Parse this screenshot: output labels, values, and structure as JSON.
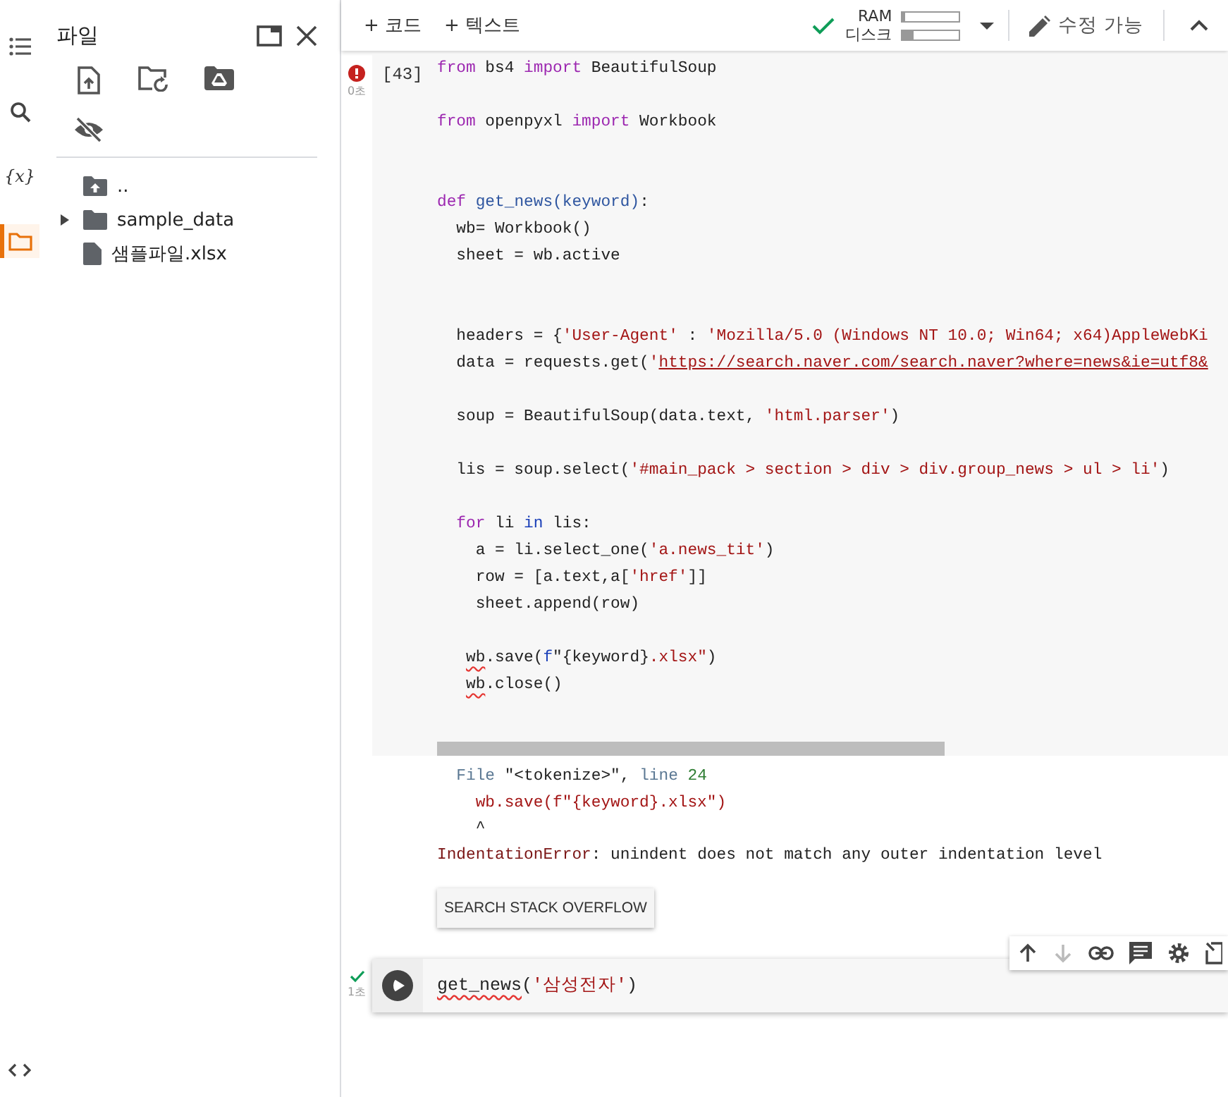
{
  "rail": {
    "items": [
      {
        "kind": "toc",
        "selected": false
      },
      {
        "kind": "search",
        "selected": false
      },
      {
        "kind": "variables",
        "glyph": "{x}",
        "selected": false
      },
      {
        "kind": "files",
        "selected": true
      }
    ]
  },
  "files_panel": {
    "title": "파일",
    "actions": [
      {
        "kind": "upload"
      },
      {
        "kind": "refresh-folder"
      },
      {
        "kind": "drive"
      },
      {
        "kind": "hide"
      }
    ],
    "tree": [
      {
        "name": "..",
        "kind": "parent"
      },
      {
        "name": "sample_data",
        "kind": "folder",
        "expanded": false
      },
      {
        "name": "샘플파일.xlsx",
        "kind": "file"
      }
    ]
  },
  "toolbar": {
    "add_buttons": [
      "+ 코드",
      "+ 텍스트"
    ],
    "ram_label": "RAM",
    "ram": {
      "level": 0.06
    },
    "disk_label": "디스크",
    "disk": {
      "level": 0.2
    },
    "connected": true,
    "edit_label": "수정 가능"
  },
  "cells": [
    {
      "error": true,
      "time": "0초",
      "count": "[43]",
      "lines": [
        {
          "kind": "code",
          "tokens": [
            {
              "kind": "keyword",
              "text": "from"
            },
            {
              "kind": "plain",
              "text": " bs4 "
            },
            {
              "kind": "keyword",
              "text": "import"
            },
            {
              "kind": "plain",
              "text": " BeautifulSoup"
            }
          ]
        },
        {
          "kind": "blank"
        },
        {
          "kind": "code",
          "tokens": [
            {
              "kind": "keyword",
              "text": "from"
            },
            {
              "kind": "plain",
              "text": " openpyxl "
            },
            {
              "kind": "keyword",
              "text": "import"
            },
            {
              "kind": "plain",
              "text": " Workbook"
            }
          ]
        },
        {
          "kind": "blank"
        },
        {
          "kind": "blank"
        },
        {
          "kind": "code",
          "tokens": [
            {
              "kind": "keyword",
              "text": "def"
            },
            {
              "kind": "name",
              "text": " get_news(keyword)"
            },
            {
              "kind": "plain",
              "text": ":"
            }
          ]
        },
        {
          "kind": "code",
          "tokens": [
            {
              "kind": "plain",
              "text": "  wb= Workbook()"
            }
          ]
        },
        {
          "kind": "code",
          "tokens": [
            {
              "kind": "plain",
              "text": "  sheet = wb.active"
            }
          ]
        },
        {
          "kind": "blank"
        },
        {
          "kind": "blank"
        },
        {
          "kind": "code",
          "tokens": [
            {
              "kind": "plain",
              "text": "  headers = {"
            },
            {
              "kind": "string",
              "text": "'User-Agent'"
            },
            {
              "kind": "plain",
              "text": " : "
            },
            {
              "kind": "string",
              "text": "'Mozilla/5.0 (Windows NT 10.0; Win64; x64)AppleWebKi"
            }
          ]
        },
        {
          "kind": "code",
          "tokens": [
            {
              "kind": "plain",
              "text": "  data = requests.get("
            },
            {
              "kind": "string",
              "text": "'"
            },
            {
              "kind": "link",
              "text": "https://search.naver.com/search.naver?where=news&ie=utf8&"
            }
          ]
        },
        {
          "kind": "blank"
        },
        {
          "kind": "code",
          "tokens": [
            {
              "kind": "plain",
              "text": "  soup = BeautifulSoup(data.text, "
            },
            {
              "kind": "string",
              "text": "'html.parser'"
            },
            {
              "kind": "plain",
              "text": ")"
            }
          ]
        },
        {
          "kind": "blank"
        },
        {
          "kind": "code",
          "tokens": [
            {
              "kind": "plain",
              "text": "  lis = soup.select("
            },
            {
              "kind": "string",
              "text": "'#main_pack > section > div > div.group_news > ul > li'"
            },
            {
              "kind": "plain",
              "text": ")"
            }
          ]
        },
        {
          "kind": "blank"
        },
        {
          "kind": "code",
          "tokens": [
            {
              "kind": "keyword",
              "text": "  for"
            },
            {
              "kind": "plain",
              "text": " li "
            },
            {
              "kind": "operator",
              "text": "in"
            },
            {
              "kind": "plain",
              "text": " lis:"
            }
          ]
        },
        {
          "kind": "code",
          "tokens": [
            {
              "kind": "plain",
              "text": "    a = li.select_one("
            },
            {
              "kind": "string",
              "text": "'a.news_tit'"
            },
            {
              "kind": "plain",
              "text": ")"
            }
          ]
        },
        {
          "kind": "code",
          "tokens": [
            {
              "kind": "plain",
              "text": "    row = [a.text,a["
            },
            {
              "kind": "string",
              "text": "'href'"
            },
            {
              "kind": "plain",
              "text": "]]"
            }
          ]
        },
        {
          "kind": "code",
          "tokens": [
            {
              "kind": "plain",
              "text": "    sheet.append(row)"
            }
          ]
        },
        {
          "kind": "blank"
        },
        {
          "kind": "code",
          "tokens": [
            {
              "kind": "squiggle",
              "text": "   wb"
            },
            {
              "kind": "plain",
              "text": ".save("
            },
            {
              "kind": "operator",
              "text": "f"
            },
            {
              "kind": "plain",
              "text": "\"{keyword}"
            },
            {
              "kind": "string",
              "text": ".xlsx\""
            },
            {
              "kind": "plain",
              "text": ")"
            }
          ]
        },
        {
          "kind": "code",
          "tokens": [
            {
              "kind": "squiggle",
              "text": "   wb"
            },
            {
              "kind": "plain",
              "text": ".close()"
            }
          ]
        }
      ],
      "output": [
        {
          "tokens": [
            {
              "kind": "label",
              "text": "  File"
            },
            {
              "kind": "plain",
              "text": " \"<tokenize>\", "
            },
            {
              "kind": "label",
              "text": "line"
            },
            {
              "kind": "number",
              "text": " 24"
            }
          ]
        },
        {
          "tokens": [
            {
              "kind": "string",
              "text": "    wb.save(f\"{keyword}.xlsx\")"
            }
          ]
        },
        {
          "tokens": [
            {
              "kind": "plain",
              "text": "    ^"
            }
          ]
        },
        {
          "tokens": [
            {
              "kind": "error",
              "text": "IndentationError"
            },
            {
              "kind": "plain",
              "text": ": unindent does not match any outer indentation level"
            }
          ]
        }
      ],
      "action_button": "SEARCH STACK OVERFLOW"
    },
    {
      "error": false,
      "time": "1초",
      "toolbar": [
        {
          "kind": "up",
          "disabled": false
        },
        {
          "kind": "down",
          "disabled": true
        },
        {
          "kind": "link",
          "disabled": false
        },
        {
          "kind": "comment",
          "disabled": false
        },
        {
          "kind": "settings",
          "disabled": false
        },
        {
          "kind": "mirror",
          "disabled": false
        }
      ],
      "lines": [
        {
          "kind": "code",
          "tokens": [
            {
              "kind": "squiggle",
              "text": "get_news"
            },
            {
              "kind": "plain",
              "text": "("
            },
            {
              "kind": "string",
              "text": "'삼성전자'"
            },
            {
              "kind": "plain",
              "text": ")"
            }
          ]
        }
      ]
    }
  ]
}
